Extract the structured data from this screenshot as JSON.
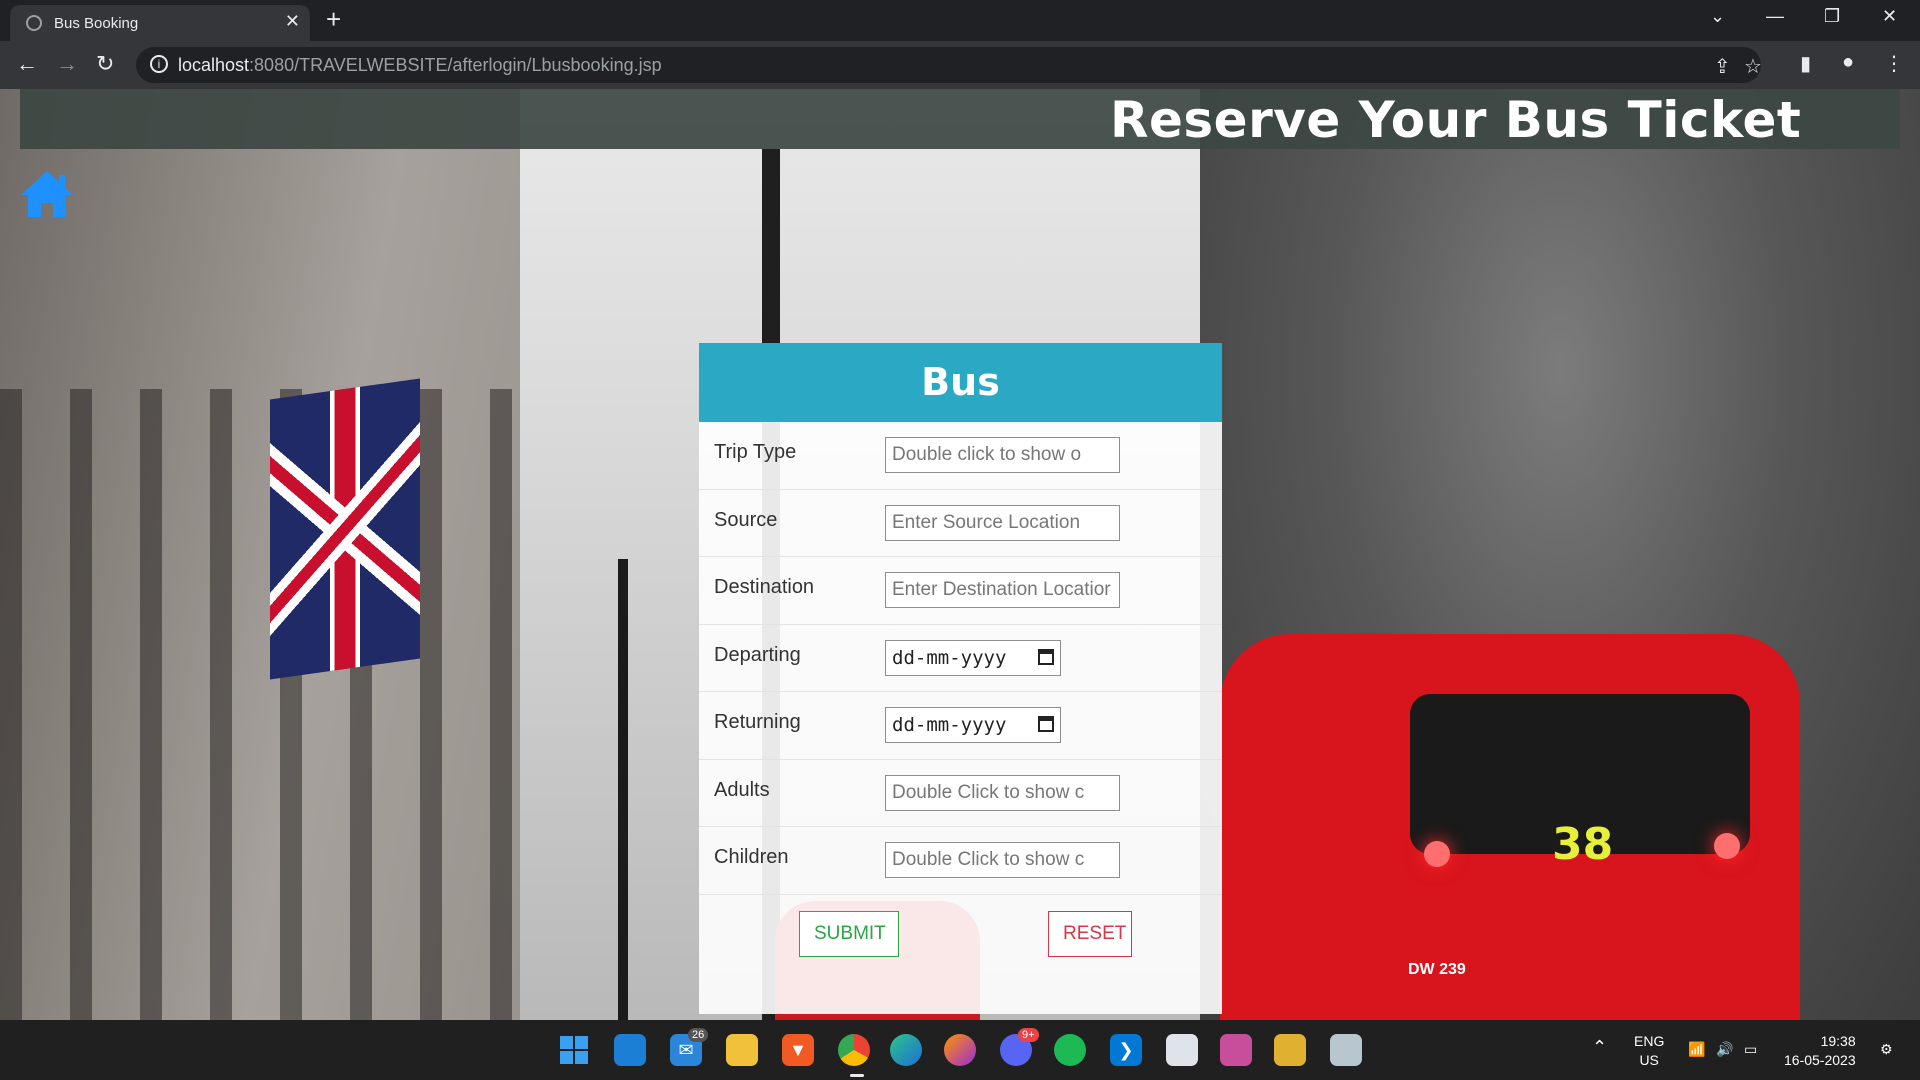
{
  "browser": {
    "tab_title": "Bus Booking",
    "url_host": "localhost",
    "url_rest": ":8080/TRAVELWEBSITE/afterlogin/Lbusbooking.jsp"
  },
  "page": {
    "banner_title": "Reserve Your Bus Ticket",
    "home_icon": "home-icon"
  },
  "background": {
    "bus_number": "38",
    "bus_plate": "DW 239"
  },
  "form": {
    "title": "Bus",
    "fields": [
      {
        "label": "Trip Type",
        "placeholder": "Double click to show o"
      },
      {
        "label": "Source",
        "placeholder": "Enter Source Location"
      },
      {
        "label": "Destination",
        "placeholder": "Enter Destination Locatior"
      },
      {
        "label": "Departing",
        "value": "dd-mm-yyyy"
      },
      {
        "label": "Returning",
        "value": "dd-mm-yyyy"
      },
      {
        "label": "Adults",
        "placeholder": "Double Click to show c"
      },
      {
        "label": "Children",
        "placeholder": "Double Click to show c"
      }
    ],
    "submit_label": "SUBMIT",
    "reset_label": "RESET"
  },
  "taskbar": {
    "mail_badge": "26",
    "discord_badge": "9+",
    "language": "ENG",
    "region": "US",
    "time": "19:38",
    "date": "16-05-2023"
  },
  "colors": {
    "form_header": "#2aa8c4",
    "submit": "#28a745",
    "reset": "#dc3545",
    "home_icon": "#1e90ff",
    "banner_bg": "#3c4642"
  }
}
